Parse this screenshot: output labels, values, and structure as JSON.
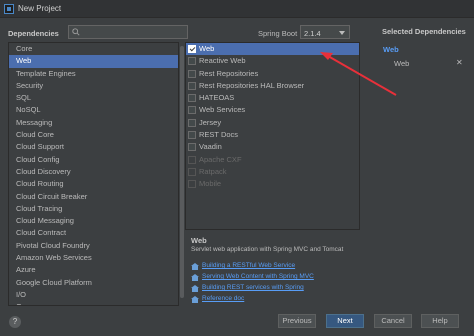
{
  "window": {
    "title": "New Project"
  },
  "header": {
    "dependencies_label": "Dependencies",
    "search": {
      "value": "",
      "placeholder": ""
    },
    "spring_boot_label": "Spring Boot",
    "spring_boot_version": "2.1.4",
    "selected_title": "Selected Dependencies"
  },
  "categories": [
    "Core",
    "Web",
    "Template Engines",
    "Security",
    "SQL",
    "NoSQL",
    "Messaging",
    "Cloud Core",
    "Cloud Support",
    "Cloud Config",
    "Cloud Discovery",
    "Cloud Routing",
    "Cloud Circuit Breaker",
    "Cloud Tracing",
    "Cloud Messaging",
    "Cloud Contract",
    "Pivotal Cloud Foundry",
    "Amazon Web Services",
    "Azure",
    "Google Cloud Platform",
    "I/O",
    "Ops"
  ],
  "selected_category": "Web",
  "dependencies": [
    {
      "label": "Web",
      "checked": true,
      "enabled": true
    },
    {
      "label": "Reactive Web",
      "checked": false,
      "enabled": true
    },
    {
      "label": "Rest Repositories",
      "checked": false,
      "enabled": true
    },
    {
      "label": "Rest Repositories HAL Browser",
      "checked": false,
      "enabled": true
    },
    {
      "label": "HATEOAS",
      "checked": false,
      "enabled": true
    },
    {
      "label": "Web Services",
      "checked": false,
      "enabled": true
    },
    {
      "label": "Jersey",
      "checked": false,
      "enabled": true
    },
    {
      "label": "REST Docs",
      "checked": false,
      "enabled": true
    },
    {
      "label": "Vaadin",
      "checked": false,
      "enabled": true
    },
    {
      "label": "Apache CXF",
      "checked": false,
      "enabled": false
    },
    {
      "label": "Ratpack",
      "checked": false,
      "enabled": false
    },
    {
      "label": "Mobile",
      "checked": false,
      "enabled": false
    }
  ],
  "description": {
    "title": "Web",
    "text": "Servlet web application with Spring MVC and Tomcat",
    "links": [
      "Building a RESTful Web Service",
      "Serving Web Content with Spring MVC",
      "Building REST services with Spring",
      "Reference doc"
    ]
  },
  "selected": {
    "group": "Web",
    "items": [
      "Web"
    ],
    "remove_glyph": "✕"
  },
  "footer": {
    "help_glyph": "?",
    "previous": "Previous",
    "next": "Next",
    "cancel": "Cancel",
    "help": "Help"
  },
  "colors": {
    "background": "#3c3f41",
    "selection": "#4b6eaf",
    "link": "#589df6",
    "annotation_arrow": "#e8303a"
  }
}
